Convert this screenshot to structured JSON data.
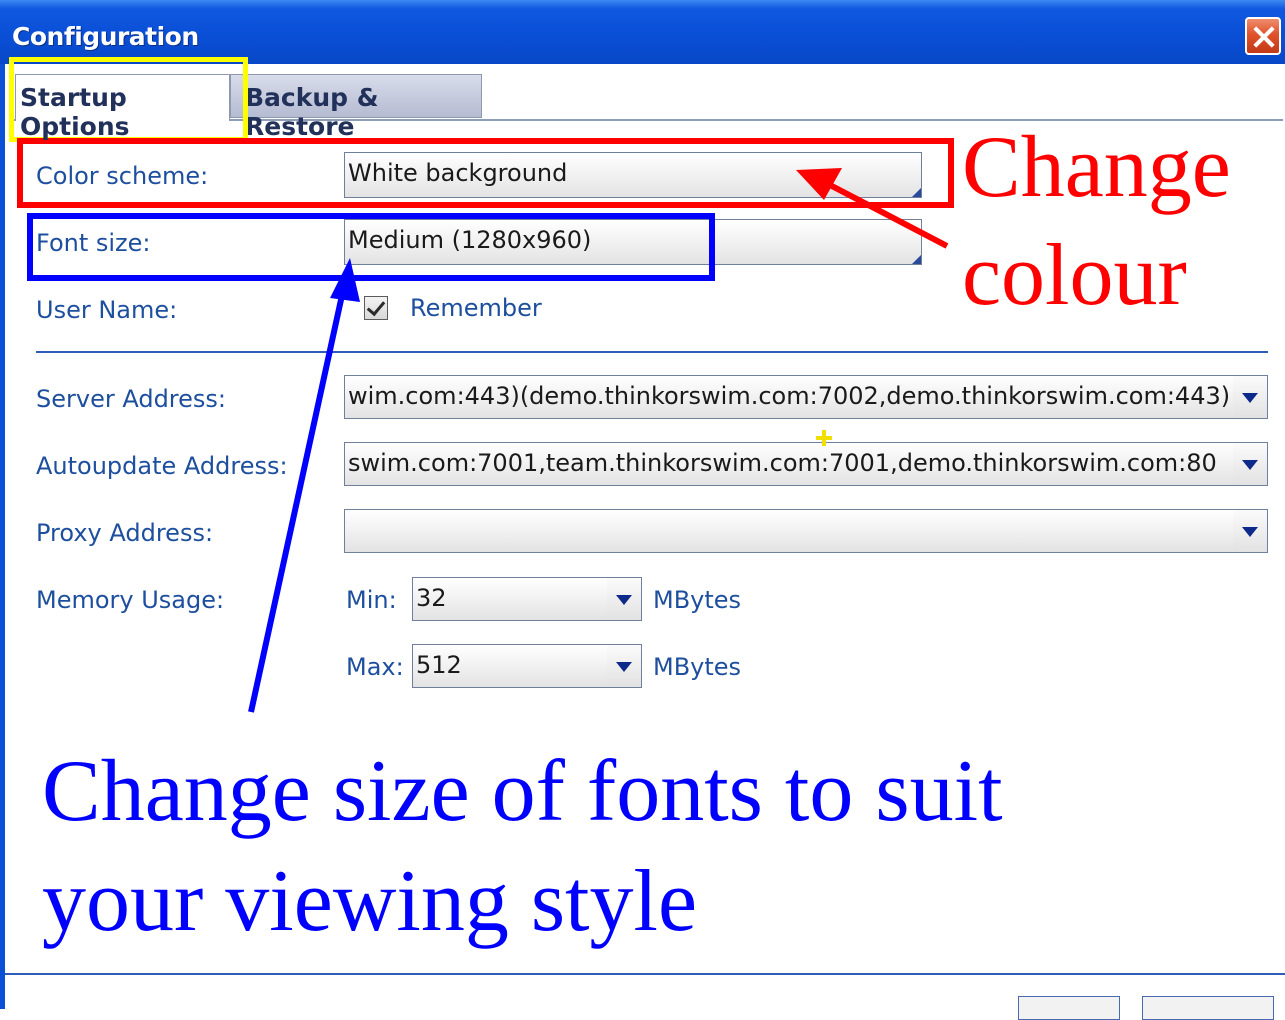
{
  "window": {
    "title": "Configuration",
    "close_icon": "close-icon"
  },
  "tabs": [
    {
      "label": "Startup Options",
      "active": true
    },
    {
      "label": "Backup & Restore",
      "active": false
    }
  ],
  "form": {
    "color_scheme": {
      "label": "Color scheme:",
      "value": "White background"
    },
    "font_size": {
      "label": "Font size:",
      "value": "Medium (1280x960)"
    },
    "user_name": {
      "label": "User Name:",
      "remember_label": "Remember",
      "remember_checked": true
    },
    "server_address": {
      "label": "Server Address:",
      "value": "wim.com:443)(demo.thinkorswim.com:7002,demo.thinkorswim.com:443)"
    },
    "autoupdate_address": {
      "label": "Autoupdate Address:",
      "value": "swim.com:7001,team.thinkorswim.com:7001,demo.thinkorswim.com:80"
    },
    "proxy_address": {
      "label": "Proxy Address:",
      "value": ""
    },
    "memory_usage": {
      "label": "Memory Usage:",
      "min_label": "Min:",
      "min_value": "32",
      "max_label": "Max:",
      "max_value": "512",
      "unit": "MBytes"
    }
  },
  "annotations": {
    "change_colour": [
      "Change",
      "colour"
    ],
    "change_fonts": [
      "Change size of fonts to suit",
      "your viewing style"
    ],
    "colors": {
      "red": "#ff0000",
      "blue": "#0000ff",
      "yellow": "#ffff00"
    }
  }
}
